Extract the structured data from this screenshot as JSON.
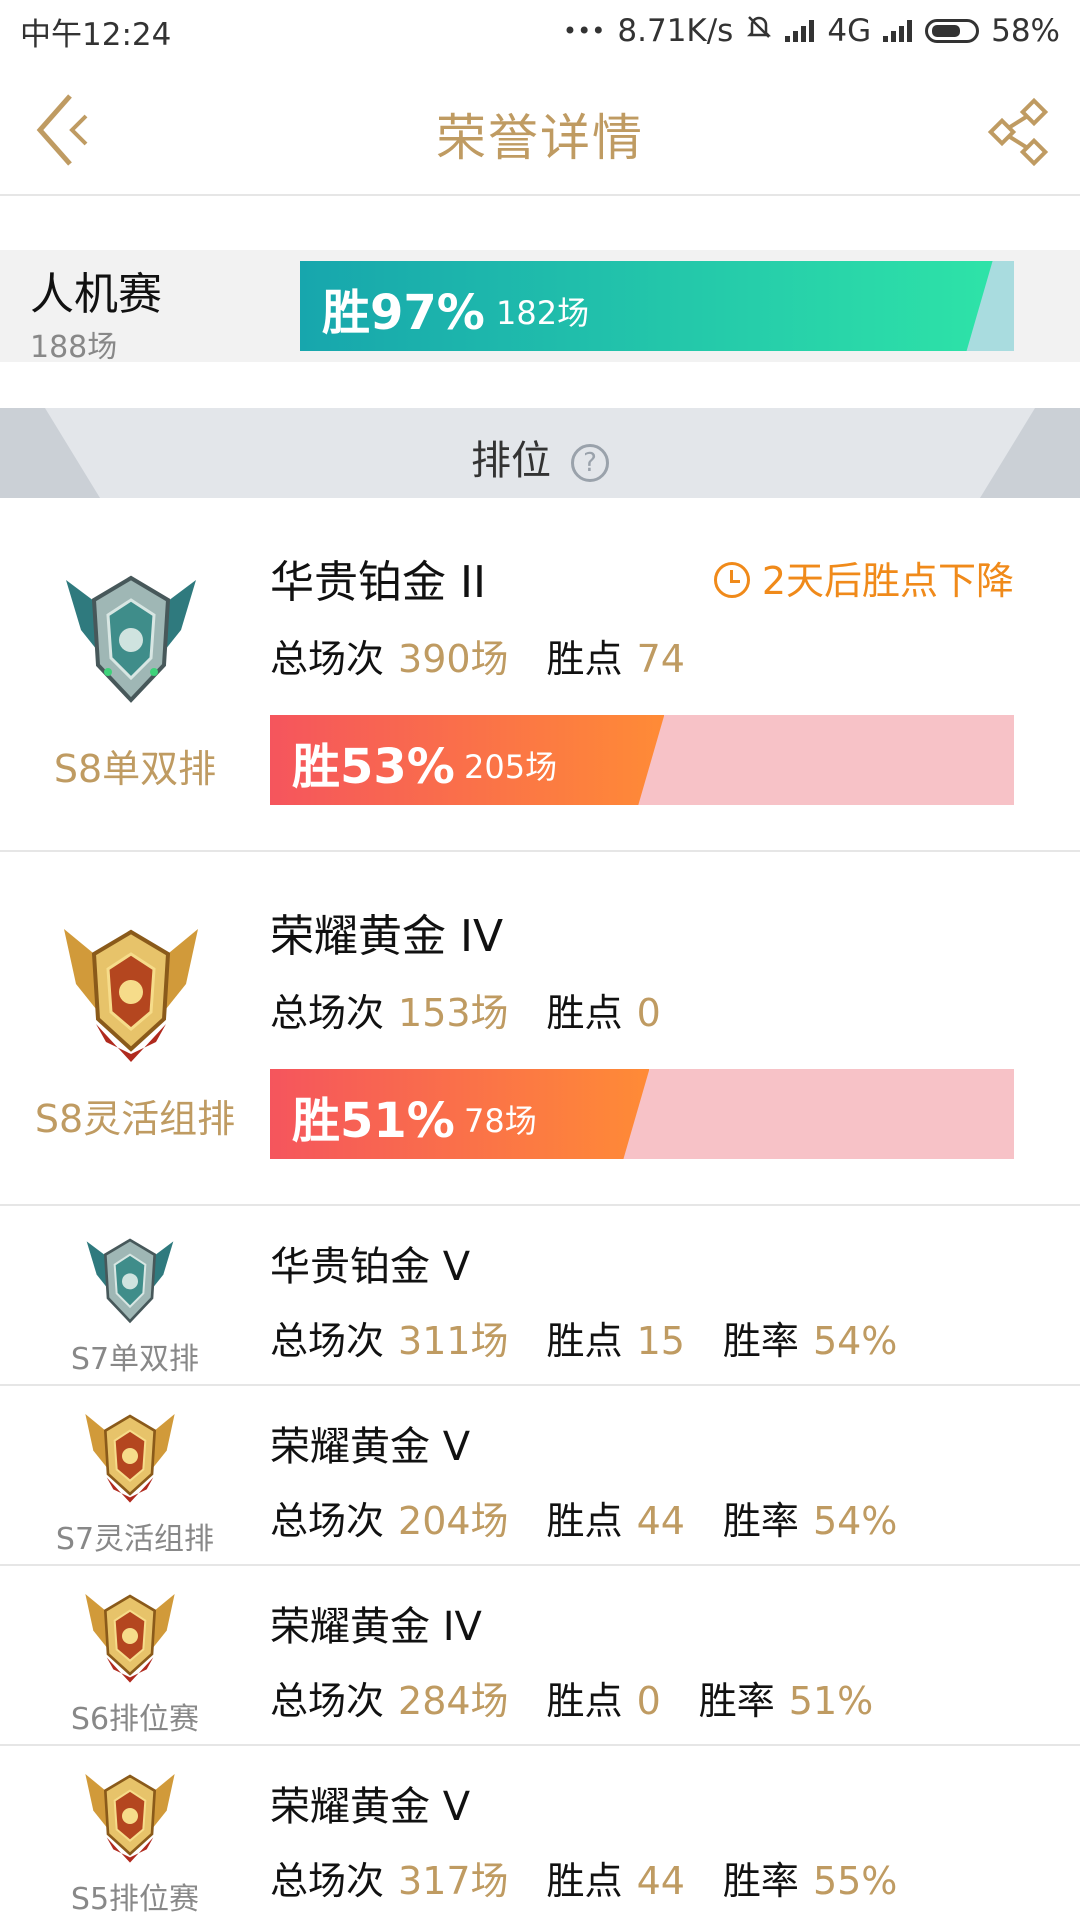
{
  "status_bar": {
    "time": "中午12:24",
    "dots": "•••",
    "speed": "8.71K/s",
    "network": "4G",
    "battery": "58%"
  },
  "header": {
    "title": "荣誉详情",
    "back_icon": "back-chevron-icon",
    "share_icon": "share-icon"
  },
  "pve": {
    "name": "人机赛",
    "count": "188场",
    "win_label": "胜97%",
    "win_games": "182场",
    "win_rate": 0.97
  },
  "rank_section": {
    "title": "排位",
    "help_icon": "?"
  },
  "current_seasons": [
    {
      "season": "S8单双排",
      "tier": "华贵铂金 II",
      "emblem": "platinum",
      "total_label": "总场次",
      "total": "390场",
      "points_label": "胜点",
      "points": "74",
      "decay": "2天后胜点下降",
      "win_label": "胜53%",
      "win_games": "205场",
      "win_rate": 0.53
    },
    {
      "season": "S8灵活组排",
      "tier": "荣耀黄金 IV",
      "emblem": "gold",
      "total_label": "总场次",
      "total": "153场",
      "points_label": "胜点",
      "points": "0",
      "win_label": "胜51%",
      "win_games": "78场",
      "win_rate": 0.51
    }
  ],
  "past_seasons": [
    {
      "season": "S7单双排",
      "tier": "华贵铂金 V",
      "emblem": "platinum",
      "total_label": "总场次",
      "total": "311场",
      "points_label": "胜点",
      "points": "15",
      "rate_label": "胜率",
      "rate": "54%"
    },
    {
      "season": "S7灵活组排",
      "tier": "荣耀黄金 V",
      "emblem": "gold",
      "total_label": "总场次",
      "total": "204场",
      "points_label": "胜点",
      "points": "44",
      "rate_label": "胜率",
      "rate": "54%"
    },
    {
      "season": "S6排位赛",
      "tier": "荣耀黄金 IV",
      "emblem": "gold",
      "total_label": "总场次",
      "total": "284场",
      "points_label": "胜点",
      "points": "0",
      "rate_label": "胜率",
      "rate": "51%"
    },
    {
      "season": "S5排位赛",
      "tier": "荣耀黄金 V",
      "emblem": "gold",
      "total_label": "总场次",
      "total": "317场",
      "points_label": "胜点",
      "points": "44",
      "rate_label": "胜率",
      "rate": "55%"
    }
  ],
  "colors": {
    "accent": "#bf9b62",
    "decay": "#f08a1a",
    "pve_bar": "#17a6ad",
    "rank_bar": "#f5555d"
  }
}
